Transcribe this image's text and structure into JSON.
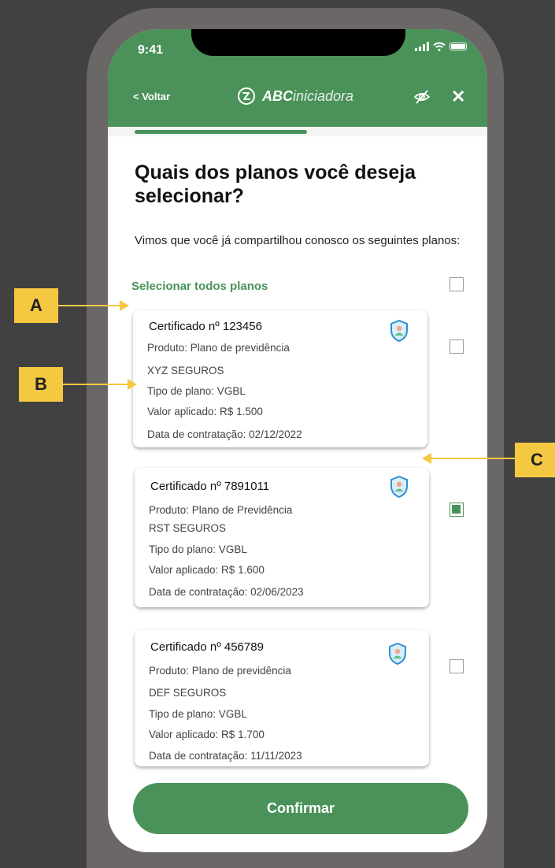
{
  "status_bar": {
    "time": "9:41"
  },
  "nav": {
    "back_label": "< Voltar",
    "brand_bold": "ABC",
    "brand_light": "iniciadora",
    "close_label": "✕"
  },
  "progress": {
    "value": 0.53
  },
  "page": {
    "title": "Quais dos planos você deseja selecionar?",
    "subtitle": "Vimos que você já compartilhou conosco os seguintes planos:",
    "select_all_label": "Selecionar todos planos",
    "select_all_checked": false
  },
  "plans": [
    {
      "title": "Certificado nº 123456",
      "product": "Produto: Plano de previdência",
      "insurer": "XYZ SEGUROS",
      "plan_type": "Tipo de plano: VGBL",
      "value": "Valor aplicado: R$ 1.500",
      "date": "Data de contratação: 02/12/2022",
      "checked": false
    },
    {
      "title": "Certificado nº 7891011",
      "product": "Produto: Plano de Previdência",
      "insurer": "RST SEGUROS",
      "plan_type": "Tipo do plano: VGBL",
      "value": "Valor aplicado: R$ 1.600",
      "date": "Data de contratação: 02/06/2023",
      "checked": true
    },
    {
      "title": "Certificado nº 456789",
      "product": "Produto: Plano de previdência",
      "insurer": "DEF SEGUROS",
      "plan_type": "Tipo de plano: VGBL",
      "value": "Valor aplicado: R$ 1.700",
      "date": "Data de contratação: 11/11/2023",
      "checked": false
    }
  ],
  "confirm_label": "Confirmar",
  "annotations": {
    "a": "A",
    "b": "B",
    "c": "C"
  },
  "colors": {
    "brand_green": "#4a9259",
    "annotation_yellow": "#f5c842",
    "background": "#414141",
    "frame": "#6b6767"
  },
  "icons": {
    "logo": "abc-logo-icon",
    "hide": "eye-off-icon",
    "close": "close-icon",
    "plan": "shield-person-icon"
  }
}
